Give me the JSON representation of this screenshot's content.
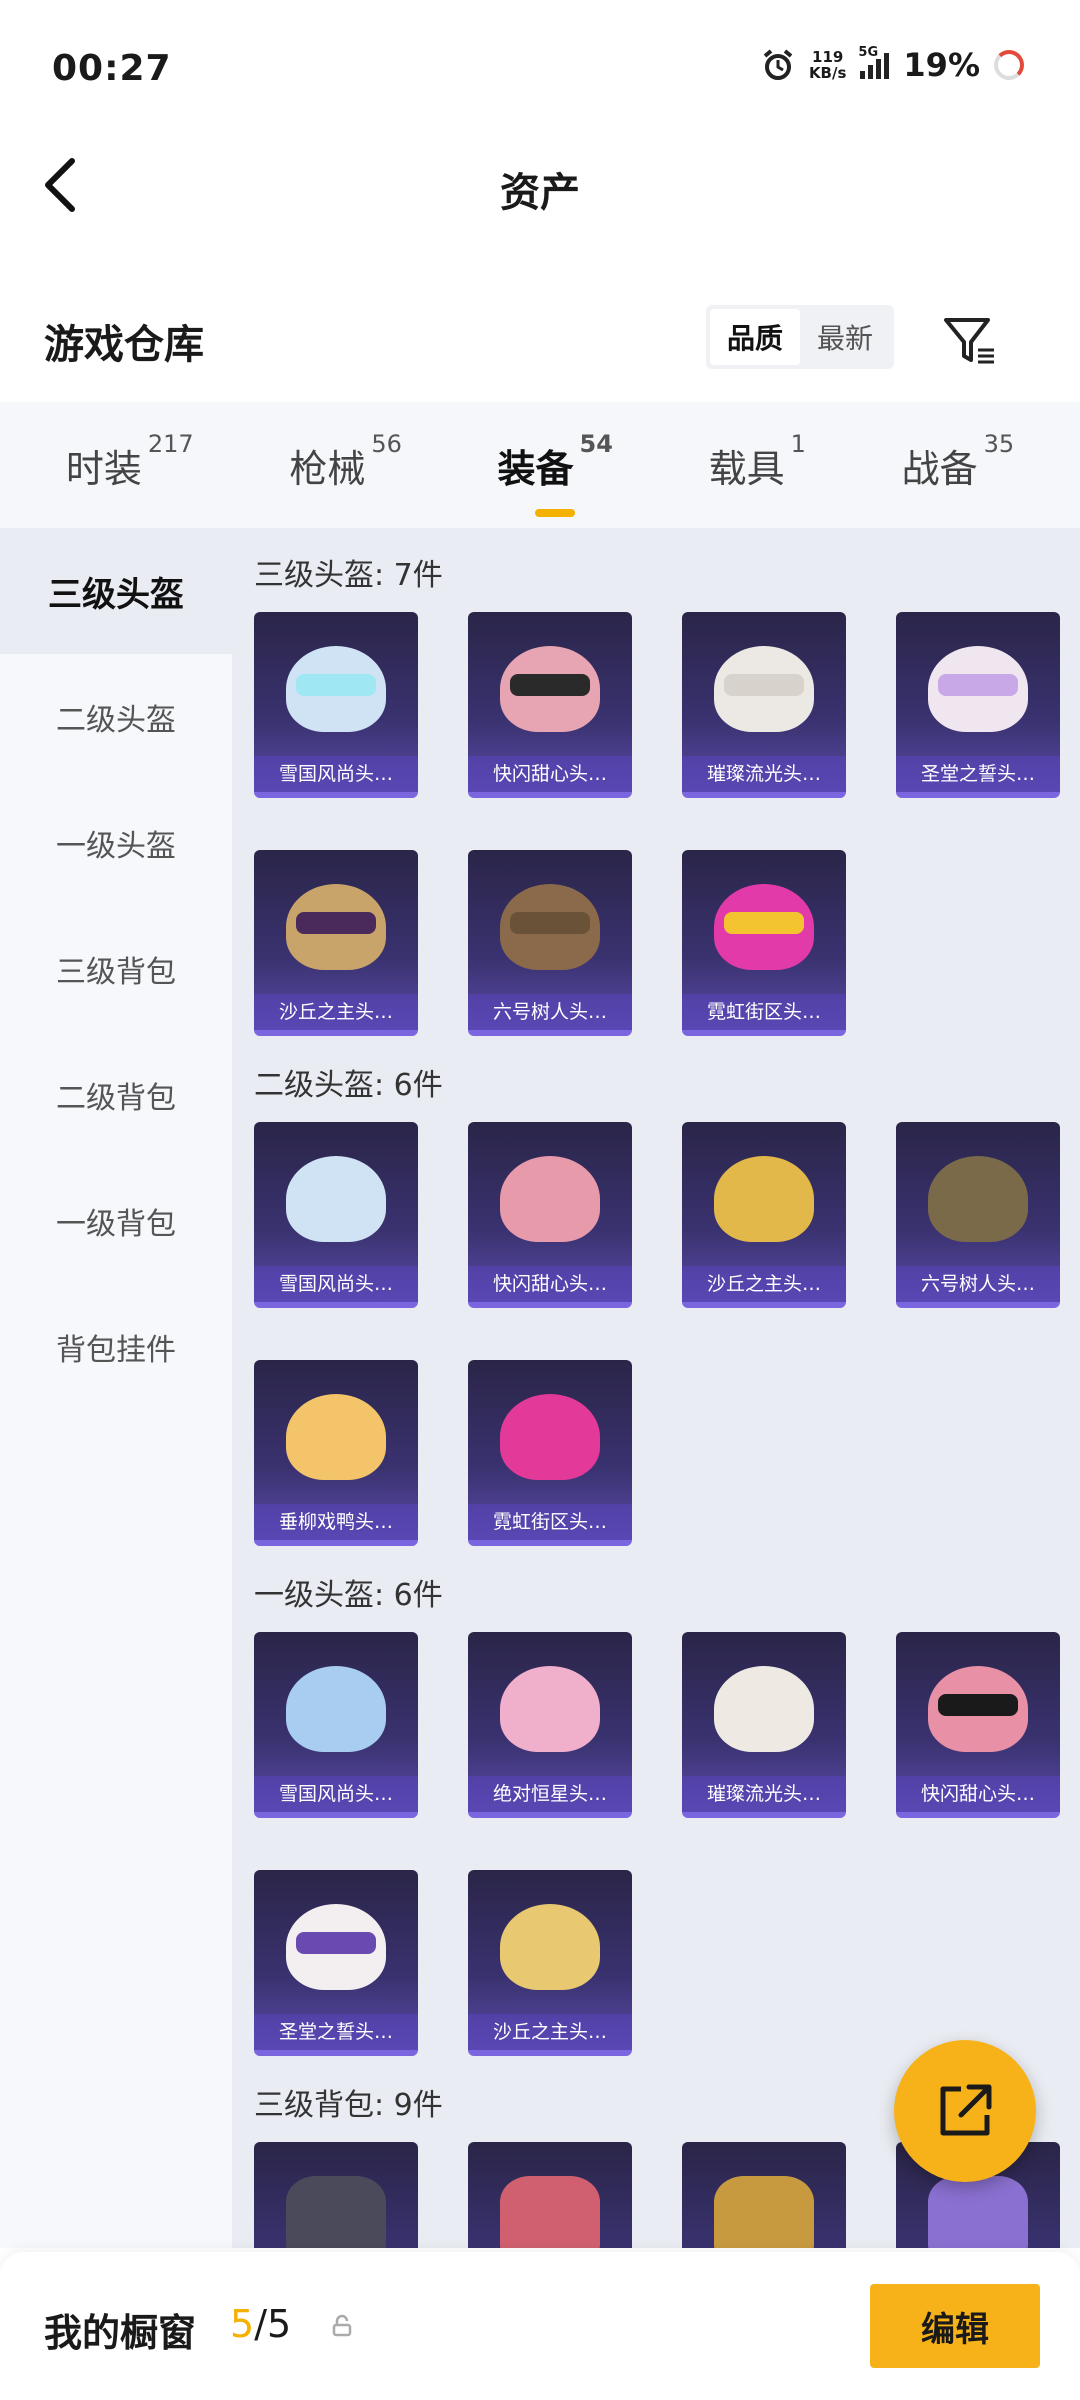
{
  "status": {
    "time": "00:27",
    "speed_value": "119",
    "speed_unit": "KB/s",
    "network": "5G",
    "battery": "19%"
  },
  "header": {
    "title": "资产"
  },
  "warehouse": {
    "title": "游戏仓库",
    "sort_options": [
      "品质",
      "最新"
    ],
    "sort_active": "品质"
  },
  "tabs": [
    {
      "label": "时装",
      "count": "217"
    },
    {
      "label": "枪械",
      "count": "56"
    },
    {
      "label": "装备",
      "count": "54",
      "active": true
    },
    {
      "label": "载具",
      "count": "1"
    },
    {
      "label": "战备",
      "count": "35"
    }
  ],
  "sidebar": [
    {
      "label": "三级头盔",
      "active": true
    },
    {
      "label": "二级头盔"
    },
    {
      "label": "一级头盔"
    },
    {
      "label": "三级背包"
    },
    {
      "label": "二级背包"
    },
    {
      "label": "一级背包"
    },
    {
      "label": "背包挂件"
    }
  ],
  "groups": [
    {
      "title": "三级头盔: 7件",
      "items": [
        "雪国风尚头…",
        "快闪甜心头…",
        "璀璨流光头…",
        "圣堂之誓头…",
        "沙丘之主头…",
        "六号树人头…",
        "霓虹街区头…"
      ]
    },
    {
      "title": "二级头盔: 6件",
      "items": [
        "雪国风尚头…",
        "快闪甜心头…",
        "沙丘之主头…",
        "六号树人头…",
        "垂柳戏鸭头…",
        "霓虹街区头…"
      ]
    },
    {
      "title": "一级头盔: 6件",
      "items": [
        "雪国风尚头…",
        "绝对恒星头…",
        "璀璨流光头…",
        "快闪甜心头…",
        "圣堂之誓头…",
        "沙丘之主头…"
      ]
    },
    {
      "title": "三级背包: 9件",
      "items": [
        "",
        "",
        "",
        ""
      ]
    }
  ],
  "bottom": {
    "showcase_label": "我的橱窗",
    "count_current": "5",
    "count_total": "/5",
    "edit_label": "编辑"
  },
  "colors": {
    "accent": "#f7b21a",
    "card_bg": "#3a3270"
  }
}
